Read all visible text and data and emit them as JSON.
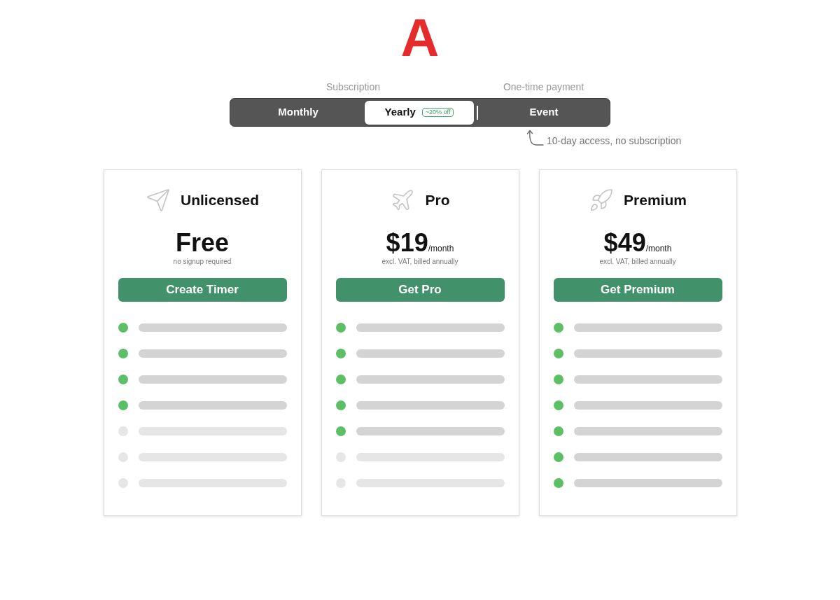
{
  "logo": {
    "text": "A"
  },
  "billing": {
    "groups": [
      {
        "label": "Subscription",
        "tabs": [
          {
            "label": "Monthly",
            "selected": false
          },
          {
            "label": "Yearly",
            "selected": true,
            "badge": "~20% off"
          }
        ]
      },
      {
        "label": "One-time payment",
        "tabs": [
          {
            "label": "Event",
            "selected": false
          }
        ]
      }
    ],
    "note": "10-day access, no subscription"
  },
  "plans": [
    {
      "kind": "paper-plane",
      "name": "Unlicensed",
      "price": "Free",
      "subtitle": "no signup required",
      "button": "Create Timer",
      "features": [
        {
          "included": true
        },
        {
          "included": true
        },
        {
          "included": true
        },
        {
          "included": true
        },
        {
          "included": false
        },
        {
          "included": false
        },
        {
          "included": false
        }
      ]
    },
    {
      "kind": "airplane",
      "name": "Pro",
      "price": "$19",
      "period": "/month",
      "subtitle": "excl. VAT, billed annually",
      "button": "Get Pro",
      "features": [
        {
          "included": true
        },
        {
          "included": true
        },
        {
          "included": true
        },
        {
          "included": true
        },
        {
          "included": true
        },
        {
          "included": false
        },
        {
          "included": false
        }
      ]
    },
    {
      "kind": "rocket",
      "name": "Premium",
      "price": "$49",
      "period": "/month",
      "subtitle": "excl. VAT, billed annually",
      "button": "Get Premium",
      "features": [
        {
          "included": true
        },
        {
          "included": true
        },
        {
          "included": true
        },
        {
          "included": true
        },
        {
          "included": true
        },
        {
          "included": true
        },
        {
          "included": true
        }
      ]
    }
  ]
}
